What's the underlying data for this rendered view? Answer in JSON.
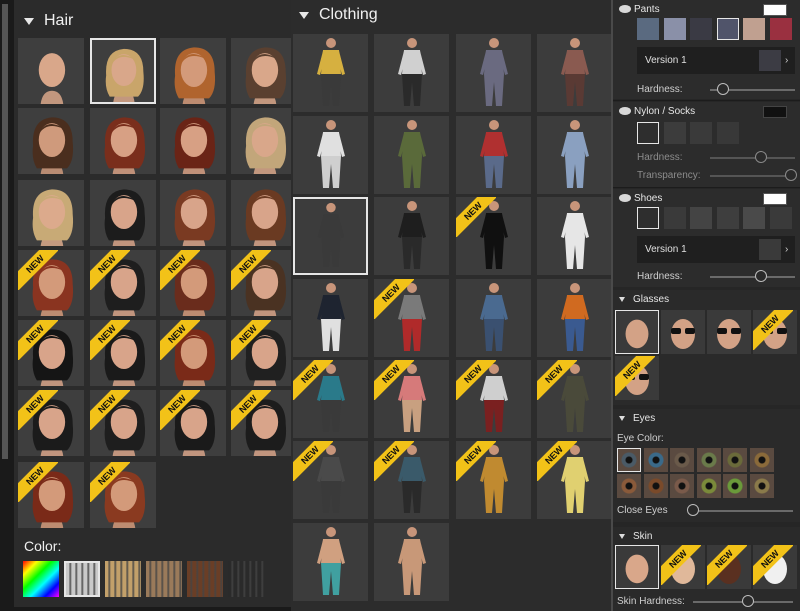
{
  "hair": {
    "title": "Hair",
    "color_label": "Color:",
    "items": [
      {
        "name": "Bald",
        "skin": "#d9a78a",
        "hair": null,
        "new": false
      },
      {
        "name": "Blonde ponytail",
        "skin": "#d9a78a",
        "hair": "#c9a56a",
        "new": false
      },
      {
        "name": "Ginger short",
        "skin": "#d39a7a",
        "hair": "#b0642e",
        "new": false
      },
      {
        "name": "Brown wavy",
        "skin": "#d9a78a",
        "hair": "#5a4030",
        "new": false
      },
      {
        "name": "Dark curly",
        "skin": "#cf9a7c",
        "hair": "#4a2e1e",
        "new": false
      },
      {
        "name": "Red long",
        "skin": "#d7a084",
        "hair": "#7a2e1c",
        "new": false
      },
      {
        "name": "Red layered",
        "skin": "#d7a084",
        "hair": "#6a2416",
        "new": false
      },
      {
        "name": "Hat",
        "skin": "#d9a78a",
        "hair": "#c2a67a",
        "new": false
      },
      {
        "name": "Blonde bob",
        "skin": "#dcaa8c",
        "hair": "#c8aa76",
        "new": false
      },
      {
        "name": "Black bob",
        "skin": "#d8a48a",
        "hair": "#1c1c1c",
        "new": false
      },
      {
        "name": "Auburn long",
        "skin": "#d8a48a",
        "hair": "#7a3a22",
        "new": false
      },
      {
        "name": "Brown long",
        "skin": "#d8a48a",
        "hair": "#6a3a22",
        "new": false
      },
      {
        "name": "Red curls",
        "skin": "#d39a7a",
        "hair": "#8a3420",
        "new": true
      },
      {
        "name": "Black bun",
        "skin": "#d8a48a",
        "hair": "#1e1e1e",
        "new": true
      },
      {
        "name": "Auburn wavy",
        "skin": "#d39a7a",
        "hair": "#6a2c1c",
        "new": true
      },
      {
        "name": "Brown ponytail",
        "skin": "#d8a48a",
        "hair": "#4a3222",
        "new": true
      },
      {
        "name": "Black straight",
        "skin": "#d8a48a",
        "hair": "#151515",
        "new": true
      },
      {
        "name": "Black fringe",
        "skin": "#d8a48a",
        "hair": "#1a1a1a",
        "new": true
      },
      {
        "name": "Red braid",
        "skin": "#d39a7a",
        "hair": "#7a2a18",
        "new": true
      },
      {
        "name": "Black side",
        "skin": "#d8a48a",
        "hair": "#202020",
        "new": true
      },
      {
        "name": "Black short",
        "skin": "#d8a48a",
        "hair": "#1b1b1b",
        "new": true
      },
      {
        "name": "Black messy bun",
        "skin": "#d8a48a",
        "hair": "#1e1e1e",
        "new": true
      },
      {
        "name": "Black pigtails",
        "skin": "#d8a48a",
        "hair": "#1a1a1a",
        "new": true
      },
      {
        "name": "Black updo",
        "skin": "#d8a48a",
        "hair": "#1c1c1c",
        "new": true
      },
      {
        "name": "Red ponytail",
        "skin": "#d39a7a",
        "hair": "#7a2a18",
        "new": true
      },
      {
        "name": "Red pixie",
        "skin": "#d39a7a",
        "hair": "#8a3a20",
        "new": true
      }
    ],
    "swatches": [
      "rainbow",
      "#c9c9c9",
      "#c2a06a",
      "#9a7a5a",
      "#6a3e26",
      "#2a2a2a"
    ]
  },
  "clothing": {
    "title": "Clothing",
    "items": [
      {
        "top": "#d6b040",
        "bottom": "#3a3a3a",
        "new": false
      },
      {
        "top": "#d0d0d0",
        "bottom": "#2a2a2a",
        "new": false
      },
      {
        "top": "#6a6a80",
        "bottom": "#6a6a80",
        "new": false
      },
      {
        "top": "#8a5a50",
        "bottom": "#5a3a34",
        "new": false
      },
      {
        "top": "#e0e0e0",
        "bottom": "#cfcfcf",
        "new": false
      },
      {
        "top": "#5a6a3a",
        "bottom": "#5a6a3a",
        "new": false
      },
      {
        "top": "#b03030",
        "bottom": "#5a6a8a",
        "new": false
      },
      {
        "top": "#8aa0c0",
        "bottom": "#8aa0c0",
        "new": false
      },
      {
        "top": "#3a3a3a",
        "bottom": "#3a3a3a",
        "new": false
      },
      {
        "top": "#1e1e1e",
        "bottom": "#2a2a2a",
        "new": false
      },
      {
        "top": "#101010",
        "bottom": "#101010",
        "new": true
      },
      {
        "top": "#e6e6e6",
        "bottom": "#e6e6e6",
        "new": false
      },
      {
        "top": "#1e2430",
        "bottom": "#e0e0e0",
        "new": false
      },
      {
        "top": "#7a7a7a",
        "bottom": "#b02a2a",
        "new": true
      },
      {
        "top": "#4a6a90",
        "bottom": "#3a5070",
        "new": false
      },
      {
        "top": "#d06a20",
        "bottom": "#3a5a90",
        "new": false
      },
      {
        "top": "#2a7a8a",
        "bottom": "#3a3a3a",
        "new": true
      },
      {
        "top": "#d67a7a",
        "bottom": "#c8a080",
        "new": true
      },
      {
        "top": "#cfcfcf",
        "bottom": "#7a2020",
        "new": true
      },
      {
        "top": "#4a4a3a",
        "bottom": "#4a4a3a",
        "new": true
      },
      {
        "top": "#4a4a4a",
        "bottom": "#3a3a3a",
        "new": true
      },
      {
        "top": "#3a5a6a",
        "bottom": "#2a2a2a",
        "new": true
      },
      {
        "top": "#c08a30",
        "bottom": "#c08a30",
        "new": true
      },
      {
        "top": "#e0d070",
        "bottom": "#e0d070",
        "new": true
      },
      {
        "top": "#d0a080",
        "bottom": "#40a0a0",
        "new": false
      },
      {
        "top": "#c89878",
        "bottom": "#c89878",
        "new": false
      }
    ]
  },
  "right": {
    "pants": {
      "title": "Pants",
      "version": "Version 1",
      "hardness_label": "Hardness:",
      "hardness": 0.15
    },
    "nylon": {
      "title": "Nylon / Socks",
      "hardness_label": "Hardness:",
      "hardness": 0.6,
      "transparency_label": "Transparency:",
      "transparency": 0.95
    },
    "shoes": {
      "title": "Shoes",
      "version": "Version 1",
      "hardness_label": "Hardness:",
      "hardness": 0.6
    },
    "glasses": {
      "title": "Glasses",
      "new_count": 2
    },
    "eyes": {
      "title": "Eyes",
      "color_label": "Eye Color:",
      "close_label": "Close Eyes",
      "close": 0.0,
      "colors": [
        "#4a5a66",
        "#3a6a8a",
        "#6a5a4a",
        "#6a7a4a",
        "#6a6a3a",
        "#8a6a3a",
        "#8a5a3a",
        "#7a4a2a",
        "#7a5a4a",
        "#7a8a3a",
        "#6a9a3a",
        "#8a7a4a"
      ]
    },
    "skin": {
      "title": "Skin",
      "hardness_label": "Skin Hardness:",
      "hardness": 0.55,
      "tones": [
        "#d9a78a",
        "#e0b89a",
        "#5a3020",
        "#f0f0f0"
      ]
    }
  }
}
